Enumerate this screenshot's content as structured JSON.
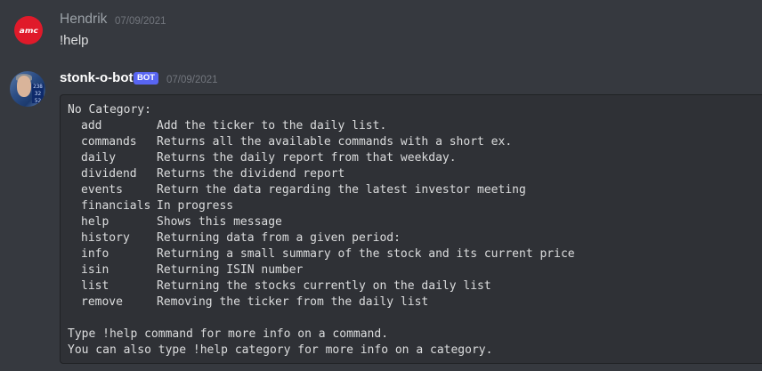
{
  "messages": [
    {
      "username": "Hendrik",
      "timestamp": "07/09/2021",
      "avatar_icon": "amc-logo-icon",
      "avatar_text": "amc",
      "text": "!help"
    },
    {
      "username": "stonk-o-bot",
      "badge": "BOT",
      "timestamp": "07/09/2021",
      "avatar_icon": "bot-avatar-icon",
      "avatar_screen": [
        "238",
        "32",
        "52"
      ]
    }
  ],
  "help_output": {
    "heading": "No Category:",
    "commands": [
      {
        "name": "add",
        "desc": "Add the ticker to the daily list."
      },
      {
        "name": "commands",
        "desc": "Returns all the available commands with a short ex."
      },
      {
        "name": "daily",
        "desc": "Returns the daily report from that weekday."
      },
      {
        "name": "dividend",
        "desc": "Returns the dividend report"
      },
      {
        "name": "events",
        "desc": "Return the data regarding the latest investor meeting"
      },
      {
        "name": "financials",
        "desc": "In progress"
      },
      {
        "name": "help",
        "desc": "Shows this message"
      },
      {
        "name": "history",
        "desc": "Returning data from a given period:"
      },
      {
        "name": "info",
        "desc": "Returning a small summary of the stock and its current price"
      },
      {
        "name": "isin",
        "desc": "Returning ISIN number"
      },
      {
        "name": "list",
        "desc": "Returning the stocks currently on the daily list"
      },
      {
        "name": "remove",
        "desc": "Removing the ticker from the daily list"
      }
    ],
    "footer": [
      "Type !help command for more info on a command.",
      "You can also type !help category for more info on a category."
    ]
  },
  "colors": {
    "background": "#36393f",
    "codeblock": "#2f3136",
    "bot_badge": "#5865f2",
    "amc_red": "#e01a2a"
  }
}
